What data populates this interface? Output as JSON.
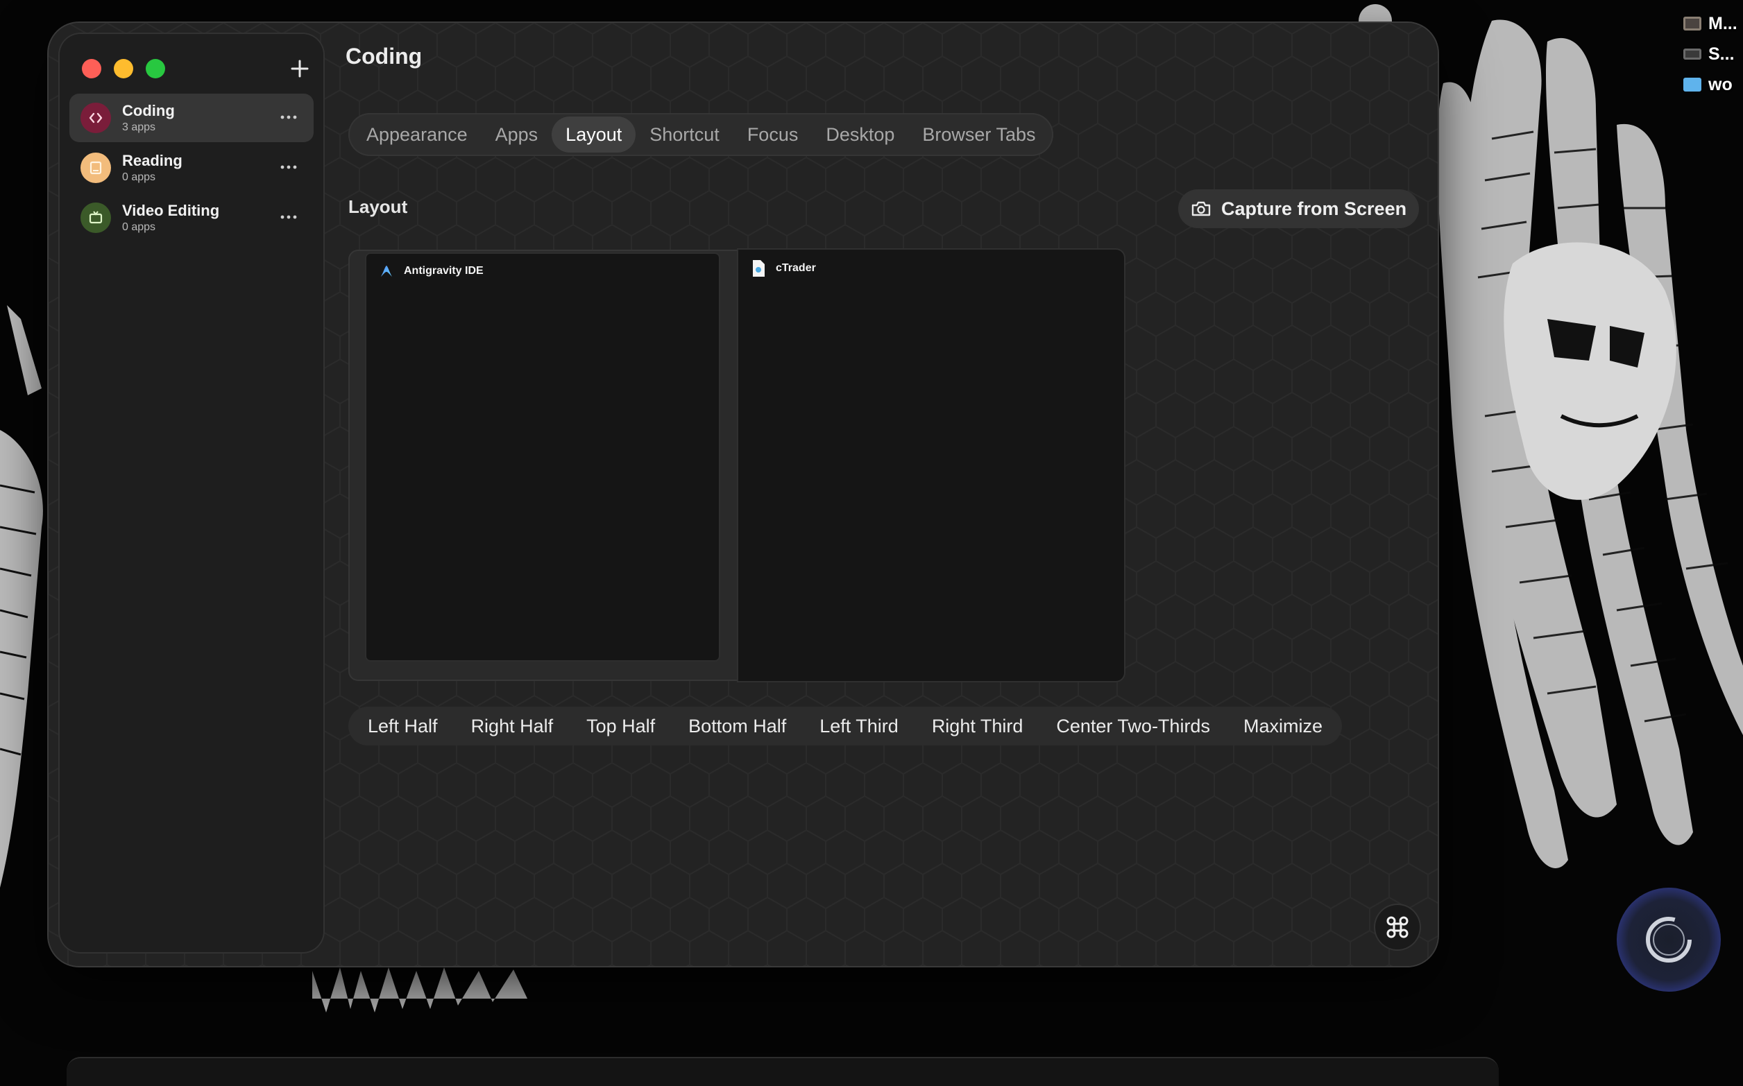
{
  "desktop": {
    "items": [
      {
        "label": "M...",
        "icon": "disk-image-icon",
        "color": "#8a7f73"
      },
      {
        "label": "S...",
        "icon": "drive-icon",
        "color": "#5a5a5a"
      },
      {
        "label": "wo",
        "icon": "folder-icon",
        "color": "#5fb3ec"
      }
    ]
  },
  "window": {
    "title": "Coding"
  },
  "sidebar": {
    "workspaces": [
      {
        "name": "Coding",
        "count": "3 apps",
        "icon": "code-brackets-icon",
        "color": "#7a1d3a",
        "selected": true
      },
      {
        "name": "Reading",
        "count": "0 apps",
        "icon": "book-icon",
        "color": "#f2bc7c",
        "selected": false
      },
      {
        "name": "Video Editing",
        "count": "0 apps",
        "icon": "tv-icon",
        "color": "#3b5a29",
        "selected": false
      }
    ]
  },
  "tabs": [
    {
      "label": "Appearance",
      "active": false
    },
    {
      "label": "Apps",
      "active": false
    },
    {
      "label": "Layout",
      "active": true
    },
    {
      "label": "Shortcut",
      "active": false
    },
    {
      "label": "Focus",
      "active": false
    },
    {
      "label": "Desktop",
      "active": false
    },
    {
      "label": "Browser Tabs",
      "active": false
    }
  ],
  "layout": {
    "section_label": "Layout",
    "capture_label": "Capture from Screen",
    "windows": [
      {
        "app": "Antigravity IDE",
        "icon": "antigravity-icon"
      },
      {
        "app": "cTrader",
        "icon": "document-icon"
      }
    ],
    "presets": [
      "Left Half",
      "Right Half",
      "Top Half",
      "Bottom Half",
      "Left Third",
      "Right Third",
      "Center Two-Thirds",
      "Maximize"
    ]
  },
  "colors": {
    "close": "#fe5f57",
    "minimize": "#febc2e",
    "maximize": "#28c840",
    "active_tab": "#3f3f3f"
  }
}
